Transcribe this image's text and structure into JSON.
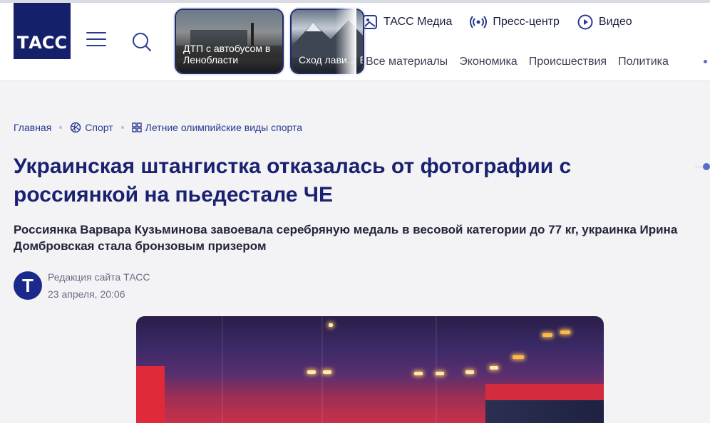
{
  "header": {
    "logo_text": "ТАСС",
    "cards": [
      {
        "text": "ДТП с автобусом в Ленобласти"
      },
      {
        "text": "Сход лави… Бурятии"
      }
    ],
    "top_links": [
      {
        "label": "ТАСС Медиа",
        "icon": "image-icon"
      },
      {
        "label": "Пресс-центр",
        "icon": "broadcast-icon"
      },
      {
        "label": "Видео",
        "icon": "play-icon"
      }
    ],
    "nav": [
      "Все материалы",
      "Экономика",
      "Происшествия",
      "Политика"
    ]
  },
  "breadcrumbs": [
    {
      "label": "Главная"
    },
    {
      "label": "Спорт",
      "icon": "volleyball-icon"
    },
    {
      "label": "Летние олимпийские виды спорта",
      "icon": "grid-icon"
    }
  ],
  "article": {
    "title": "Украинская штангистка отказалась от фотографии с россиянкой на пьедестале ЧЕ",
    "lead": "Россиянка Варвара Кузьминова завоевала серебряную медаль в весовой категории до 77 кг, украинка Ирина Домбровская стала бронзовым призером",
    "author_initial": "Т",
    "author": "Редакция сайта ТАСС",
    "date": "23 апреля, 20:06"
  },
  "colors": {
    "brand": "#15206b",
    "title": "#1a2170",
    "link": "#2b3990"
  }
}
